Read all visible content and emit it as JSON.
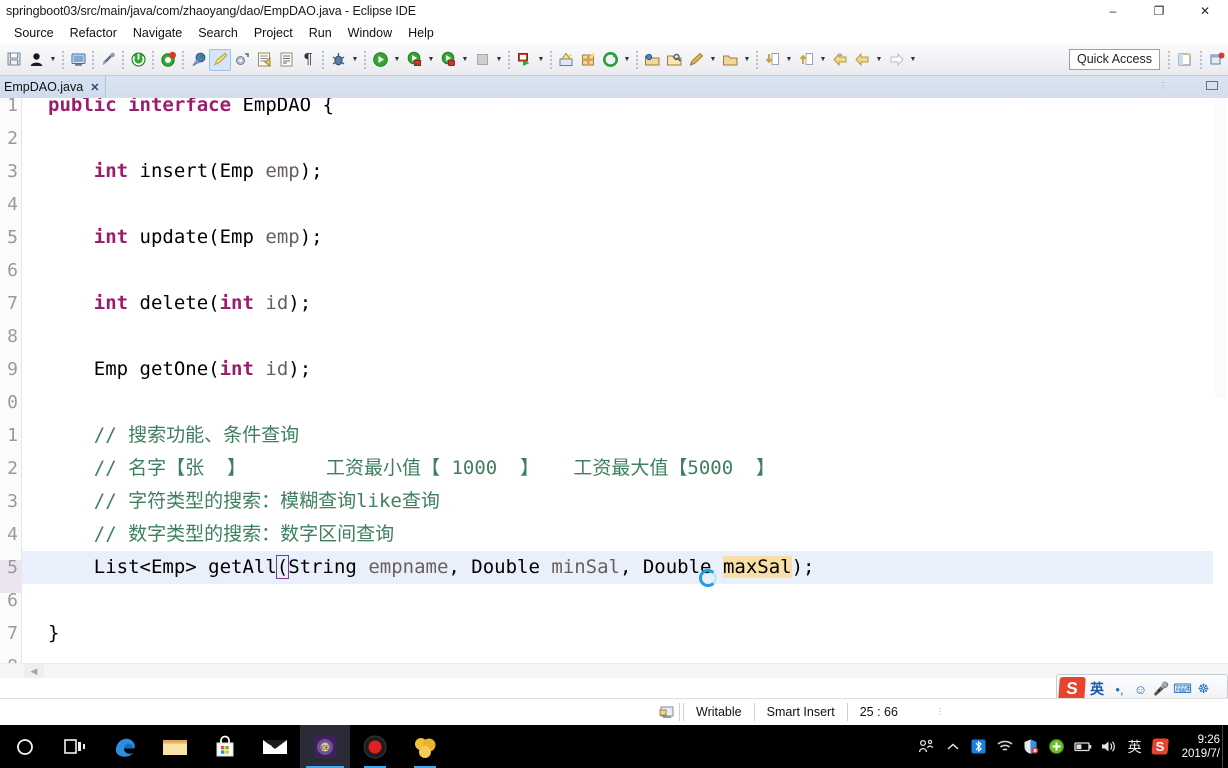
{
  "window": {
    "title": "springboot03/src/main/java/com/zhaoyang/dao/EmpDAO.java - Eclipse IDE",
    "minimize_label": "–",
    "maximize_label": "❐",
    "close_label": "✕"
  },
  "menubar": {
    "items": [
      {
        "label": "Source"
      },
      {
        "label": "Refactor"
      },
      {
        "label": "Navigate"
      },
      {
        "label": "Search"
      },
      {
        "label": "Project"
      },
      {
        "label": "Run"
      },
      {
        "label": "Window"
      },
      {
        "label": "Help"
      }
    ]
  },
  "toolbar": {
    "quick_access_placeholder": "Quick Access",
    "icons": [
      "save-icon",
      "user-icon",
      "chevron-down-icon",
      "sep",
      "new-java-class-icon",
      "sep",
      "link-break-icon",
      "sep",
      "terminate-icon",
      "sep",
      "debug-skip-icon",
      "sep",
      "breakpoint-icon",
      "marker-icon",
      "refresh-project-icon",
      "open-type-icon",
      "open-task-icon",
      "pilcrow-icon",
      "sep",
      "debug-icon",
      "chevron-down-icon",
      "sep",
      "run-icon",
      "chevron-down-icon",
      "coverage-icon",
      "chevron-down-icon",
      "profile-icon",
      "chevron-down-icon",
      "stop-icon",
      "chevron-down-icon",
      "sep",
      "run-external-icon",
      "chevron-down-icon",
      "sep",
      "new-wizard-icon",
      "new-package-icon",
      "refresh-icon",
      "chevron-down-icon",
      "sep",
      "open-resource-icon",
      "search-folder-icon",
      "edit-icon",
      "chevron-down-icon",
      "next-annotation-icon",
      "chevron-down-icon",
      "sep",
      "previous-edit-icon",
      "chevron-down-icon",
      "next-edit-icon",
      "chevron-down-icon",
      "back-icon",
      "forward-icon",
      "chevron-down-icon",
      "forward-arrow-icon",
      "chevron-down-icon"
    ],
    "perspective_icons": [
      "open-perspective-icon",
      "java-perspective-icon"
    ]
  },
  "editor": {
    "tab": {
      "label": "EmpDAO.java",
      "close_label": "✕"
    },
    "highlight_line": 25,
    "lines": [
      {
        "num": "1",
        "tokens": [
          {
            "t": "public",
            "c": "kw"
          },
          {
            "t": " "
          },
          {
            "t": "interface",
            "c": "kw"
          },
          {
            "t": " EmpDAO {"
          }
        ]
      },
      {
        "num": "2",
        "tokens": [
          {
            "t": ""
          }
        ]
      },
      {
        "num": "3",
        "tokens": [
          {
            "t": "    "
          },
          {
            "t": "int",
            "c": "kw"
          },
          {
            "t": " insert(Emp "
          },
          {
            "t": "emp",
            "c": "param"
          },
          {
            "t": ");"
          }
        ]
      },
      {
        "num": "4",
        "tokens": [
          {
            "t": ""
          }
        ]
      },
      {
        "num": "5",
        "tokens": [
          {
            "t": "    "
          },
          {
            "t": "int",
            "c": "kw"
          },
          {
            "t": " update(Emp "
          },
          {
            "t": "emp",
            "c": "param"
          },
          {
            "t": ");"
          }
        ]
      },
      {
        "num": "6",
        "tokens": [
          {
            "t": ""
          }
        ]
      },
      {
        "num": "7",
        "tokens": [
          {
            "t": "    "
          },
          {
            "t": "int",
            "c": "kw"
          },
          {
            "t": " delete("
          },
          {
            "t": "int",
            "c": "kw"
          },
          {
            "t": " "
          },
          {
            "t": "id",
            "c": "param"
          },
          {
            "t": ");"
          }
        ]
      },
      {
        "num": "8",
        "tokens": [
          {
            "t": ""
          }
        ]
      },
      {
        "num": "9",
        "tokens": [
          {
            "t": "    Emp getOne("
          },
          {
            "t": "int",
            "c": "kw"
          },
          {
            "t": " "
          },
          {
            "t": "id",
            "c": "param"
          },
          {
            "t": ");"
          }
        ]
      },
      {
        "num": "0",
        "tokens": [
          {
            "t": ""
          }
        ]
      },
      {
        "num": "1",
        "tokens": [
          {
            "t": "    // 搜索功能、条件查询",
            "c": "cmt"
          }
        ]
      },
      {
        "num": "2",
        "tokens": [
          {
            "t": "    // 名字【张  】       工资最小值【 1000  】   工资最大值【5000  】",
            "c": "cmt"
          }
        ]
      },
      {
        "num": "3",
        "tokens": [
          {
            "t": "    // 字符类型的搜索：模糊查询like查询",
            "c": "cmt"
          }
        ]
      },
      {
        "num": "4",
        "tokens": [
          {
            "t": "    // 数字类型的搜索：数字区间查询",
            "c": "cmt"
          }
        ]
      },
      {
        "num": "5",
        "tokens": [
          {
            "t": "    List<Emp> getAll"
          },
          {
            "t": "(",
            "c": "brkt"
          },
          {
            "t": "String "
          },
          {
            "t": "empname",
            "c": "param"
          },
          {
            "t": ", Double "
          },
          {
            "t": "minSal",
            "c": "param"
          },
          {
            "t": ", Double "
          },
          {
            "t": "maxSal",
            "c": "sel"
          },
          {
            "t": ");"
          }
        ]
      },
      {
        "num": "6",
        "tokens": [
          {
            "t": ""
          }
        ]
      },
      {
        "num": "7",
        "tokens": [
          {
            "t": "}"
          }
        ]
      },
      {
        "num": "8",
        "tokens": [
          {
            "t": ""
          }
        ]
      }
    ]
  },
  "statusbar": {
    "writable": "Writable",
    "insert_mode": "Smart Insert",
    "position": "25 : 66",
    "icon": "editor-status-icon"
  },
  "ime": {
    "logo": "S",
    "mode": "英",
    "items": [
      "voice-dot-icon",
      "emoji-icon",
      "microphone-icon",
      "keyboard-icon",
      "toolbox-icon"
    ]
  },
  "taskbar": {
    "items": [
      {
        "name": "cortana-search-icon",
        "glyph": "○"
      },
      {
        "name": "task-view-icon",
        "glyph": "⧉"
      },
      {
        "name": "edge-browser-icon",
        "glyph": "e"
      },
      {
        "name": "file-explorer-icon",
        "glyph": "🗀"
      },
      {
        "name": "microsoft-store-icon",
        "glyph": "❖"
      },
      {
        "name": "mail-icon",
        "glyph": "✉"
      },
      {
        "name": "eclipse-ide-icon",
        "glyph": "⚙"
      },
      {
        "name": "screen-recorder-icon",
        "glyph": "⬤"
      },
      {
        "name": "media-app-icon",
        "glyph": "◕"
      }
    ],
    "tray": [
      {
        "name": "people-icon",
        "glyph": "ʀ"
      },
      {
        "name": "show-hidden-icons-icon",
        "glyph": "∧"
      },
      {
        "name": "bluetooth-icon",
        "glyph": "ᛗ"
      },
      {
        "name": "wifi-icon",
        "glyph": "◠"
      },
      {
        "name": "security-shield-icon",
        "glyph": "⛨"
      },
      {
        "name": "antivirus-icon",
        "glyph": "+"
      },
      {
        "name": "battery-icon",
        "glyph": "▭"
      },
      {
        "name": "volume-icon",
        "glyph": "🔊"
      },
      {
        "name": "ime-language-icon",
        "glyph": "英"
      },
      {
        "name": "sogou-ime-tray-icon",
        "glyph": "S"
      }
    ],
    "clock_time": "9:26",
    "clock_date": "2019/7/"
  }
}
